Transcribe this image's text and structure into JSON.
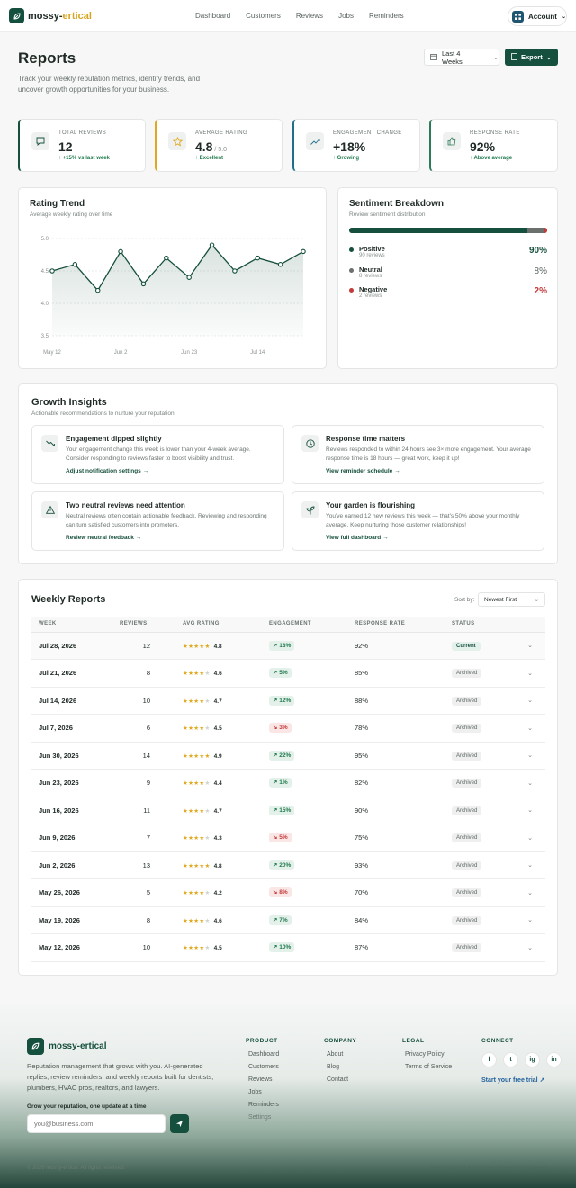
{
  "brand": {
    "name_main": "mossy-",
    "name_accent": "ertical",
    "footer_name": "mossy-ertical",
    "accent": "#154f3d",
    "gold": "#d9a520"
  },
  "nav": {
    "links": [
      "Dashboard",
      "Customers",
      "Reviews",
      "Jobs",
      "Reminders"
    ],
    "account": "Account"
  },
  "header": {
    "title": "Reports",
    "subtitle": "Track your weekly reputation metrics, identify trends, and uncover growth opportunities for your business.",
    "range": "Last 4 Weeks",
    "export": "Export"
  },
  "stats": [
    {
      "label": "Total Reviews",
      "value": "12",
      "suffix": "",
      "delta": "↑ +15% vs last week",
      "icon": "chat-icon",
      "color": "#154f3d"
    },
    {
      "label": "Average Rating",
      "value": "4.8",
      "suffix": " / 5.0",
      "delta": "↑ Excellent",
      "icon": "star-icon",
      "color": "#e0a81d"
    },
    {
      "label": "Engagement Change",
      "value": "+18%",
      "suffix": "",
      "delta": "↑ Growing",
      "icon": "trend-up-icon",
      "color": "#1f6f8b"
    },
    {
      "label": "Response Rate",
      "value": "92%",
      "suffix": "",
      "delta": "↑ Above average",
      "icon": "thumbs-up-icon",
      "color": "#2d7a5a"
    }
  ],
  "trend": {
    "title": "Rating Trend",
    "subtitle": "Average weekly rating over time"
  },
  "chart_data": {
    "type": "area",
    "title": "Rating Trend",
    "ylim": [
      3.5,
      5.0
    ],
    "yticks": [
      "5.0",
      "4.5",
      "4.0",
      "3.5"
    ],
    "xticks": [
      "May 12",
      "Jun 2",
      "Jun 23",
      "Jul 14"
    ],
    "values": [
      4.5,
      4.6,
      4.2,
      4.8,
      4.3,
      4.7,
      4.4,
      4.9,
      4.5,
      4.7,
      4.6,
      4.8
    ]
  },
  "sentiment": {
    "title": "Sentiment Breakdown",
    "subtitle": "Review sentiment distribution",
    "rows": [
      {
        "name": "Positive",
        "count": "90 reviews",
        "pct": "90%",
        "color": "#154f3d",
        "frac": 0.9
      },
      {
        "name": "Neutral",
        "count": "8 reviews",
        "pct": "8%",
        "color": "#6b706d",
        "frac": 0.08
      },
      {
        "name": "Negative",
        "count": "2 reviews",
        "pct": "2%",
        "color": "#c23a3a",
        "frac": 0.02
      }
    ]
  },
  "insights": {
    "title": "Growth Insights",
    "subtitle": "Actionable recommendations to nurture your reputation",
    "items": [
      {
        "title": "Engagement dipped slightly",
        "desc": "Your engagement change this week is lower than your 4-week average. Consider responding to reviews faster to boost visibility and trust.",
        "link": "Adjust notification settings →",
        "icon": "trend-down-icon"
      },
      {
        "title": "Response time matters",
        "desc": "Reviews responded to within 24 hours see 3× more engagement. Your average response time is 18 hours — great work, keep it up!",
        "link": "View reminder schedule →",
        "icon": "clock-icon"
      },
      {
        "title": "Two neutral reviews need attention",
        "desc": "Neutral reviews often contain actionable feedback. Reviewing and responding can turn satisfied customers into promoters.",
        "link": "Review neutral feedback →",
        "icon": "alert-icon"
      },
      {
        "title": "Your garden is flourishing",
        "desc": "You've earned 12 new reviews this week — that's 50% above your monthly average. Keep nurturing those customer relationships!",
        "link": "View full dashboard →",
        "icon": "sprout-icon"
      }
    ]
  },
  "weekly": {
    "title": "Weekly Reports",
    "sort_label": "Sort by:",
    "sort_value": "Newest First",
    "headers": [
      "Week",
      "Reviews",
      "Avg Rating",
      "Engagement",
      "Response Rate",
      "Status"
    ],
    "rows": [
      {
        "week": "Jul 28, 2026",
        "reviews": "12",
        "rating": "4.8",
        "stars": 5,
        "eng": "18%",
        "up": true,
        "resp": "92%",
        "status": "Current"
      },
      {
        "week": "Jul 21, 2026",
        "reviews": "8",
        "rating": "4.6",
        "stars": 4,
        "eng": "5%",
        "up": true,
        "resp": "85%",
        "status": "Archived"
      },
      {
        "week": "Jul 14, 2026",
        "reviews": "10",
        "rating": "4.7",
        "stars": 4,
        "eng": "12%",
        "up": true,
        "resp": "88%",
        "status": "Archived"
      },
      {
        "week": "Jul 7, 2026",
        "reviews": "6",
        "rating": "4.5",
        "stars": 4,
        "eng": "3%",
        "up": false,
        "resp": "78%",
        "status": "Archived"
      },
      {
        "week": "Jun 30, 2026",
        "reviews": "14",
        "rating": "4.9",
        "stars": 5,
        "eng": "22%",
        "up": true,
        "resp": "95%",
        "status": "Archived"
      },
      {
        "week": "Jun 23, 2026",
        "reviews": "9",
        "rating": "4.4",
        "stars": 4,
        "eng": "1%",
        "up": true,
        "resp": "82%",
        "status": "Archived"
      },
      {
        "week": "Jun 16, 2026",
        "reviews": "11",
        "rating": "4.7",
        "stars": 4,
        "eng": "15%",
        "up": true,
        "resp": "90%",
        "status": "Archived"
      },
      {
        "week": "Jun 9, 2026",
        "reviews": "7",
        "rating": "4.3",
        "stars": 4,
        "eng": "5%",
        "up": false,
        "resp": "75%",
        "status": "Archived"
      },
      {
        "week": "Jun 2, 2026",
        "reviews": "13",
        "rating": "4.8",
        "stars": 5,
        "eng": "20%",
        "up": true,
        "resp": "93%",
        "status": "Archived"
      },
      {
        "week": "May 26, 2026",
        "reviews": "5",
        "rating": "4.2",
        "stars": 4,
        "eng": "8%",
        "up": false,
        "resp": "70%",
        "status": "Archived"
      },
      {
        "week": "May 19, 2026",
        "reviews": "8",
        "rating": "4.6",
        "stars": 4,
        "eng": "7%",
        "up": true,
        "resp": "84%",
        "status": "Archived"
      },
      {
        "week": "May 12, 2026",
        "reviews": "10",
        "rating": "4.5",
        "stars": 4,
        "eng": "10%",
        "up": true,
        "resp": "87%",
        "status": "Archived"
      }
    ]
  },
  "footer": {
    "tagline": "Reputation management that grows with you. AI-generated replies, review reminders, and weekly reports built for dentists, plumbers, HVAC pros, realtors, and lawyers.",
    "newsletter_label": "Grow your reputation, one update at a time",
    "email_placeholder": "you@business.com",
    "cols": [
      {
        "title": "Product",
        "links": [
          "Dashboard",
          "Customers",
          "Reviews",
          "Jobs",
          "Reminders",
          "Settings"
        ]
      },
      {
        "title": "Company",
        "links": [
          "About",
          "Blog",
          "Contact"
        ]
      },
      {
        "title": "Legal",
        "links": [
          "Privacy Policy",
          "Terms of Service"
        ]
      }
    ],
    "connect": "Connect",
    "trial": "Start your free trial ↗",
    "social": [
      "f",
      "t",
      "ig",
      "in"
    ],
    "copyright": "© 2026 mossy-ertical. All rights reserved.",
    "credit": "Built for trades & professional services in Canada"
  }
}
